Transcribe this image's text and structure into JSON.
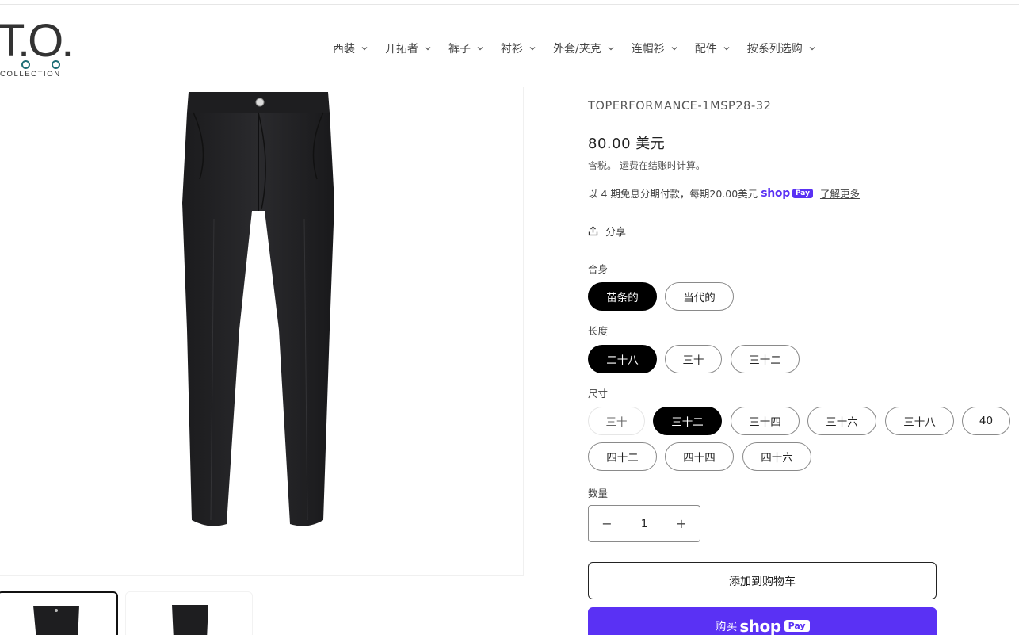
{
  "brand": {
    "logo_mark": "T.O.",
    "logo_subtext": "COLLECTION",
    "accent_color": "#1f6f77"
  },
  "nav": {
    "items": [
      {
        "label": "西装"
      },
      {
        "label": "开拓者"
      },
      {
        "label": "裤子"
      },
      {
        "label": "衬衫"
      },
      {
        "label": "外套/夹克"
      },
      {
        "label": "连帽衫"
      },
      {
        "label": "配件"
      },
      {
        "label": "按系列选购"
      }
    ],
    "chevron_icon": "chevron-down-icon"
  },
  "product": {
    "vendor_title": "TOPERFORMANCE-1MSP28-32",
    "price": "80.00 美元",
    "tax_prefix": "含税。",
    "tax_link": "运费",
    "tax_suffix": "在结账时计算。",
    "installments_text": "以 4 期免息分期付款，每期20.00美元",
    "shop_word": "shop",
    "shop_pay_badge": "Pay",
    "learn_more": "了解更多",
    "share_label": "分享"
  },
  "options": {
    "fit": {
      "label": "合身",
      "values": [
        "苗条的",
        "当代的"
      ],
      "selected": "苗条的"
    },
    "length": {
      "label": "长度",
      "values": [
        "二十八",
        "三十",
        "三十二"
      ],
      "selected": "二十八"
    },
    "size": {
      "label": "尺寸",
      "values": [
        "三十",
        "三十二",
        "三十四",
        "三十六",
        "三十八",
        "40",
        "四十二",
        "四十四",
        "四十六"
      ],
      "selected": "三十二",
      "unavailable": [
        "三十"
      ]
    }
  },
  "quantity": {
    "label": "数量",
    "value": "1",
    "minus": "−",
    "plus": "+"
  },
  "actions": {
    "add_to_cart": "添加到购物车",
    "buy_prefix": "购买",
    "buy_shop_word": "shop",
    "buy_pay_badge": "Pay",
    "shop_pay_color": "#5a31f4"
  }
}
